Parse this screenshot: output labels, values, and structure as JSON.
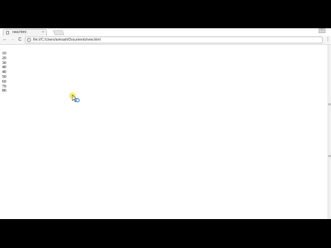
{
  "tab": {
    "title": "new.html",
    "close": "×"
  },
  "window": {
    "button_glyph": "□"
  },
  "toolbar": {
    "back": "←",
    "forward": "→",
    "reload": "C",
    "info": "i",
    "url": "file:///C:/Users/avinash/Documents/new.html",
    "menu": "⋮"
  },
  "page": {
    "numbers": [
      "10",
      "20",
      "30",
      "40",
      "40",
      "50",
      "60",
      "70",
      "80"
    ]
  },
  "icons": {
    "cursor_highlight_color": "#f4f15a",
    "cursor": "busy-cursor-icon"
  }
}
